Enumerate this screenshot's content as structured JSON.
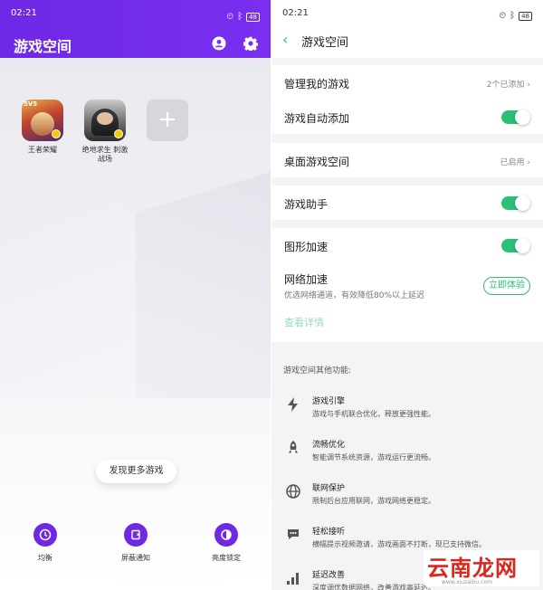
{
  "left": {
    "status_time": "02:21",
    "status_battery": "48",
    "title": "游戏空间",
    "games": [
      {
        "name": "王者荣耀",
        "badge": "5V5"
      },
      {
        "name": "绝地求生 刺激战场"
      }
    ],
    "add_label": "+",
    "more_label": "发现更多游戏",
    "bottom": [
      {
        "label": "均衡"
      },
      {
        "label": "屏蔽通知"
      },
      {
        "label": "亮度锁定"
      }
    ]
  },
  "right": {
    "status_time": "02:21",
    "status_battery": "48",
    "title": "游戏空间",
    "rows": {
      "manage_label": "管理我的游戏",
      "manage_value": "2个已添加",
      "auto_add_label": "游戏自动添加",
      "desktop_label": "桌面游戏空间",
      "desktop_value": "已启用",
      "assistant_label": "游戏助手",
      "graphics_label": "图形加速",
      "network_label": "网络加速",
      "network_desc": "优选网络通道，有效降低80%以上延迟",
      "network_button": "立即体验",
      "details_link": "查看详情"
    },
    "other_title": "游戏空间其他功能:",
    "features": [
      {
        "name": "游戏引擎",
        "desc": "游戏与手机联合优化，释放更强性能。",
        "icon": "bolt-icon"
      },
      {
        "name": "流畅优化",
        "desc": "智能调节系统资源，游戏运行更流畅。",
        "icon": "rocket-icon"
      },
      {
        "name": "联网保护",
        "desc": "限制后台应用联网，游戏网络更稳定。",
        "icon": "globe-icon"
      },
      {
        "name": "轻松接听",
        "desc": "横幅提示视频邀请，游戏画面不打断，现已支持微信。",
        "icon": "chat-icon"
      },
      {
        "name": "延迟改善",
        "desc": "深度调优数据网络，改善游戏高延迟。",
        "icon": "signal-icon"
      }
    ]
  },
  "watermark": {
    "text": "云南龙网",
    "url": "www.xiuzaibu.com"
  },
  "colors": {
    "purple": "#6e28e6",
    "green": "#2bbf78"
  }
}
